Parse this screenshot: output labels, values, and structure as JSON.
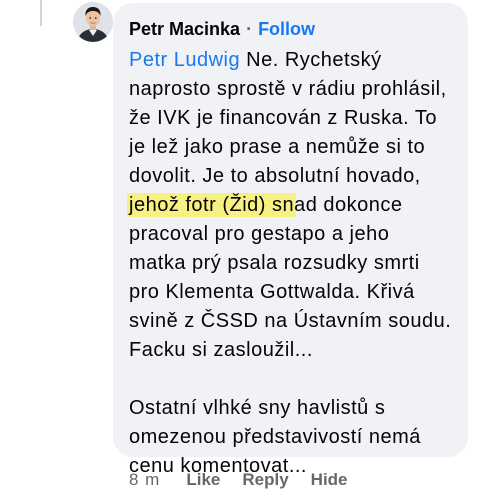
{
  "comment": {
    "author": "Petr Macinka",
    "separator": "·",
    "follow_label": "Follow",
    "line1_mention": "Petr Ludwig",
    "line1_rest": " Ne. Rychetský",
    "lines_a": [
      "naprosto sprostě v rádiu prohlásil,",
      "že IVK je financován z Ruska. To",
      "je lež jako prase a nemůže si to",
      "dovolit. Je to absolutní hovado,"
    ],
    "line6_highlight": "jehož fotr (Žid) sn",
    "line6_rest": "ad dokonce",
    "lines_b": [
      "pracoval pro gestapo a jeho",
      "matka prý psala rozsudky smrti",
      "pro Klementa Gottwalda. Křivá",
      "svině z ČSSD na Ústavním soudu.",
      "Facku si zasloužil..."
    ],
    "lines_c": [
      "Ostatní vlhké sny havlistů s",
      "omezenou představivostí nemá",
      "cenu komentovat..."
    ],
    "highlight_color": "#f7f184",
    "link_color": "#1877f2",
    "bubble_color": "#f0f2f5"
  },
  "actions": {
    "time": "8 m",
    "like": "Like",
    "reply": "Reply",
    "hide": "Hide"
  },
  "icons": {
    "avatar": "profile-photo"
  }
}
